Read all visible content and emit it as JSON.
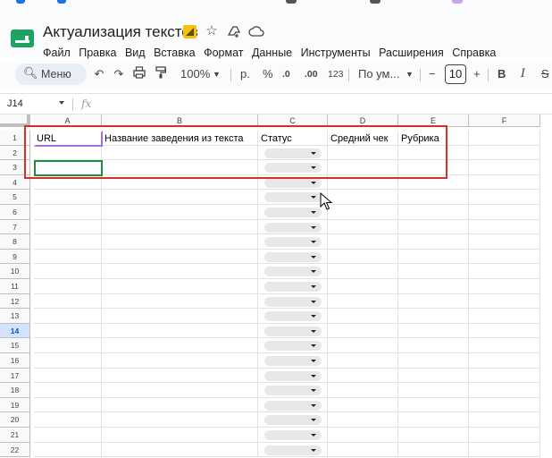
{
  "colors": {
    "accent": "#0b57d0",
    "highlight": "#d93025",
    "sheets_green": "#1ea362"
  },
  "document": {
    "title": "Актуализация текстов",
    "icons": [
      "slides-badge-icon",
      "star-icon",
      "move-to-drive-icon",
      "cloud-status-icon"
    ]
  },
  "menu": [
    "Файл",
    "Правка",
    "Вид",
    "Вставка",
    "Формат",
    "Данные",
    "Инструменты",
    "Расширения",
    "Справка"
  ],
  "toolbar": {
    "search_label": "Меню",
    "zoom": "100%",
    "currency": "р.",
    "percent": "%",
    "dec_decrease": ".0",
    "dec_increase": ".00",
    "number_format": "123",
    "font": "По ум...",
    "font_size": "10",
    "minus": "−",
    "plus": "+",
    "bold": "B",
    "italic": "I",
    "strike": "S"
  },
  "formula_bar": {
    "cell_ref": "J14",
    "fx": "fx",
    "value": ""
  },
  "sheet": {
    "columns": [
      "A",
      "B",
      "C",
      "D",
      "E",
      "F"
    ],
    "rows": [
      "1",
      "2",
      "3",
      "4",
      "5",
      "6",
      "7",
      "8",
      "9",
      "10",
      "11",
      "12",
      "13",
      "14",
      "15",
      "16",
      "17",
      "18",
      "19",
      "20",
      "21",
      "22"
    ],
    "selected_row": "14",
    "header_row": [
      "URL",
      "Название заведения из текста",
      "Статус",
      "Средний чек",
      "Рубрика",
      ""
    ],
    "status_dropdown_rows": [
      "2",
      "3",
      "4",
      "5",
      "6",
      "7",
      "8",
      "9",
      "10",
      "11",
      "12",
      "13",
      "14",
      "15",
      "16",
      "17",
      "18",
      "19",
      "20",
      "21",
      "22"
    ]
  }
}
